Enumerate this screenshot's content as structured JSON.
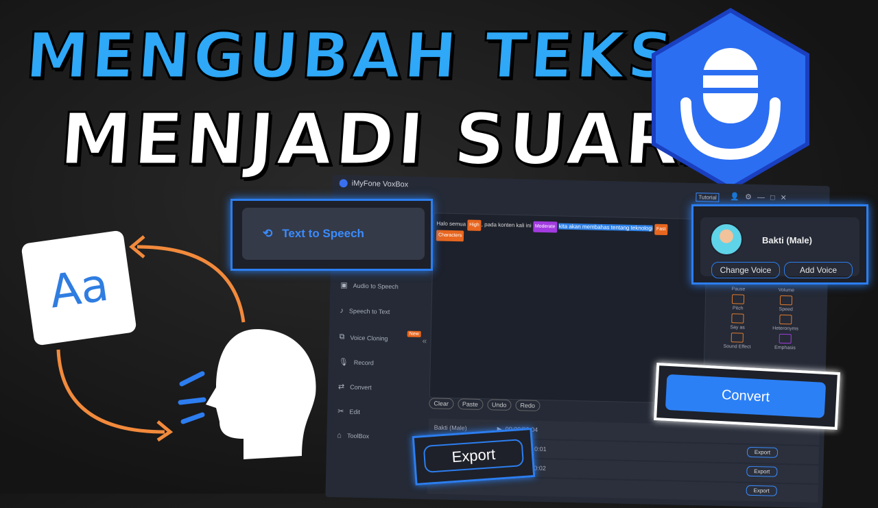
{
  "headline": {
    "line1": "MENGUBAH TEKS",
    "line2": "MENJADI SUARA"
  },
  "colors": {
    "accent": "#2ea8f7",
    "brand": "#2c7ef0",
    "orange": "#e37b2e"
  },
  "icon_card": {
    "text": "Aa"
  },
  "app": {
    "title": "iMyFone VoxBox",
    "tutorial_label": "Tutorial",
    "sidebar": {
      "active": "Text to Speech",
      "items": [
        {
          "label": "Audio to Speech",
          "icon": "audio-icon"
        },
        {
          "label": "Speech to Text",
          "icon": "speech-text-icon"
        },
        {
          "label": "Voice Cloning",
          "icon": "clone-icon",
          "badge": "New"
        },
        {
          "label": "Record",
          "icon": "mic-icon"
        },
        {
          "label": "Convert",
          "icon": "convert-icon"
        },
        {
          "label": "Edit",
          "icon": "scissors-icon"
        },
        {
          "label": "ToolBox",
          "icon": "toolbox-icon"
        }
      ]
    },
    "editor": {
      "segments": [
        {
          "text": "Halo semua",
          "tag": "High",
          "tag_color": "#e8661f"
        },
        {
          "text": "pada konten kali ini",
          "tag": "Moderate",
          "tag_color": "#a23be0"
        },
        {
          "text": "kita akan membahas tentang teknologi",
          "tag": "Fast",
          "tag_color": "#e8661f"
        }
      ],
      "extra_tag": "Characters",
      "buttons": [
        "Clear",
        "Paste",
        "Undo",
        "Redo"
      ]
    },
    "voice": {
      "name": "Bakti (Male)",
      "change": "Change Voice",
      "add": "Add Voice"
    },
    "tools": [
      "Pause",
      "Volume",
      "Pitch",
      "Speed",
      "Say as",
      "Heteronyms",
      "Sound Effect",
      "Emphasis"
    ],
    "convert_label": "Convert",
    "tracks": [
      {
        "name": "Bakti (Male)",
        "time": "00:00/00:04",
        "export": "Export"
      },
      {
        "name": "",
        "time": "0:01",
        "export": "Export"
      },
      {
        "name": "",
        "time": "0:02",
        "export": "Export"
      }
    ],
    "export_label": "Export"
  }
}
